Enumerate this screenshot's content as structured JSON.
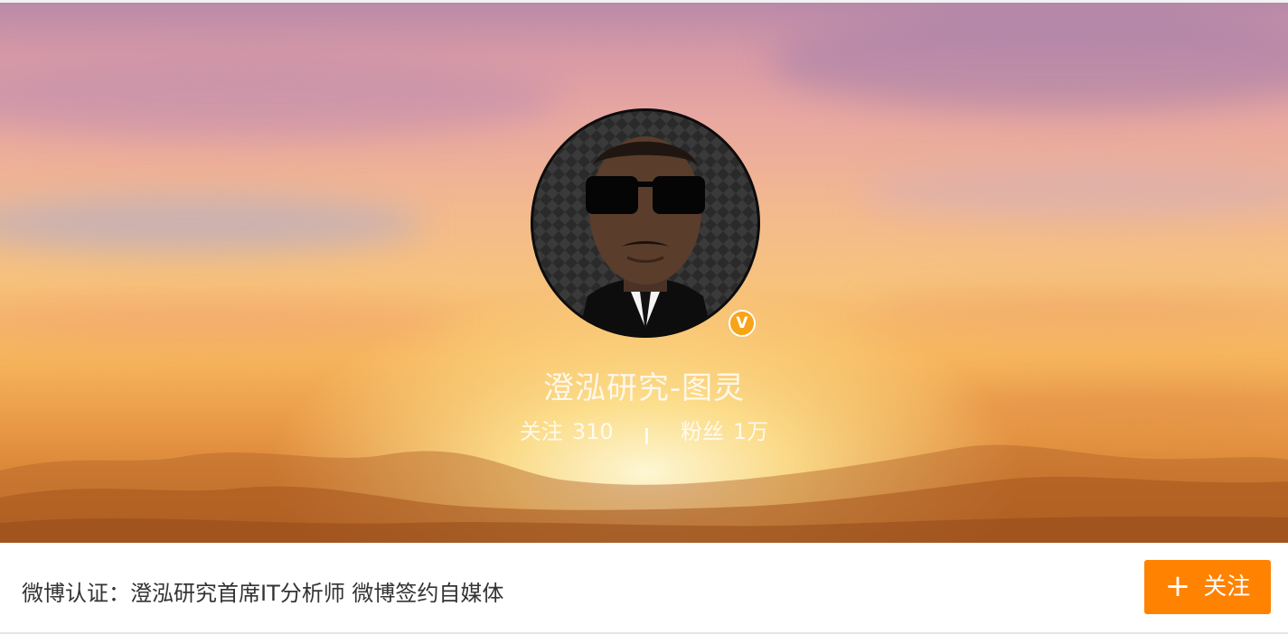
{
  "profile": {
    "name": "澄泓研究-图灵",
    "verified_badge": "V",
    "avatar_icon": "profile-photo"
  },
  "stats": {
    "following_label": "关注",
    "following_count": "310",
    "followers_label": "粉丝",
    "followers_count": "1万"
  },
  "info": {
    "verification_text": "微博认证：澄泓研究首席IT分析师 微博签约自媒体"
  },
  "actions": {
    "follow_label": "关注",
    "follow_icon": "plus-icon"
  },
  "colors": {
    "accent": "#ff8200",
    "badge": "#f7a418"
  }
}
